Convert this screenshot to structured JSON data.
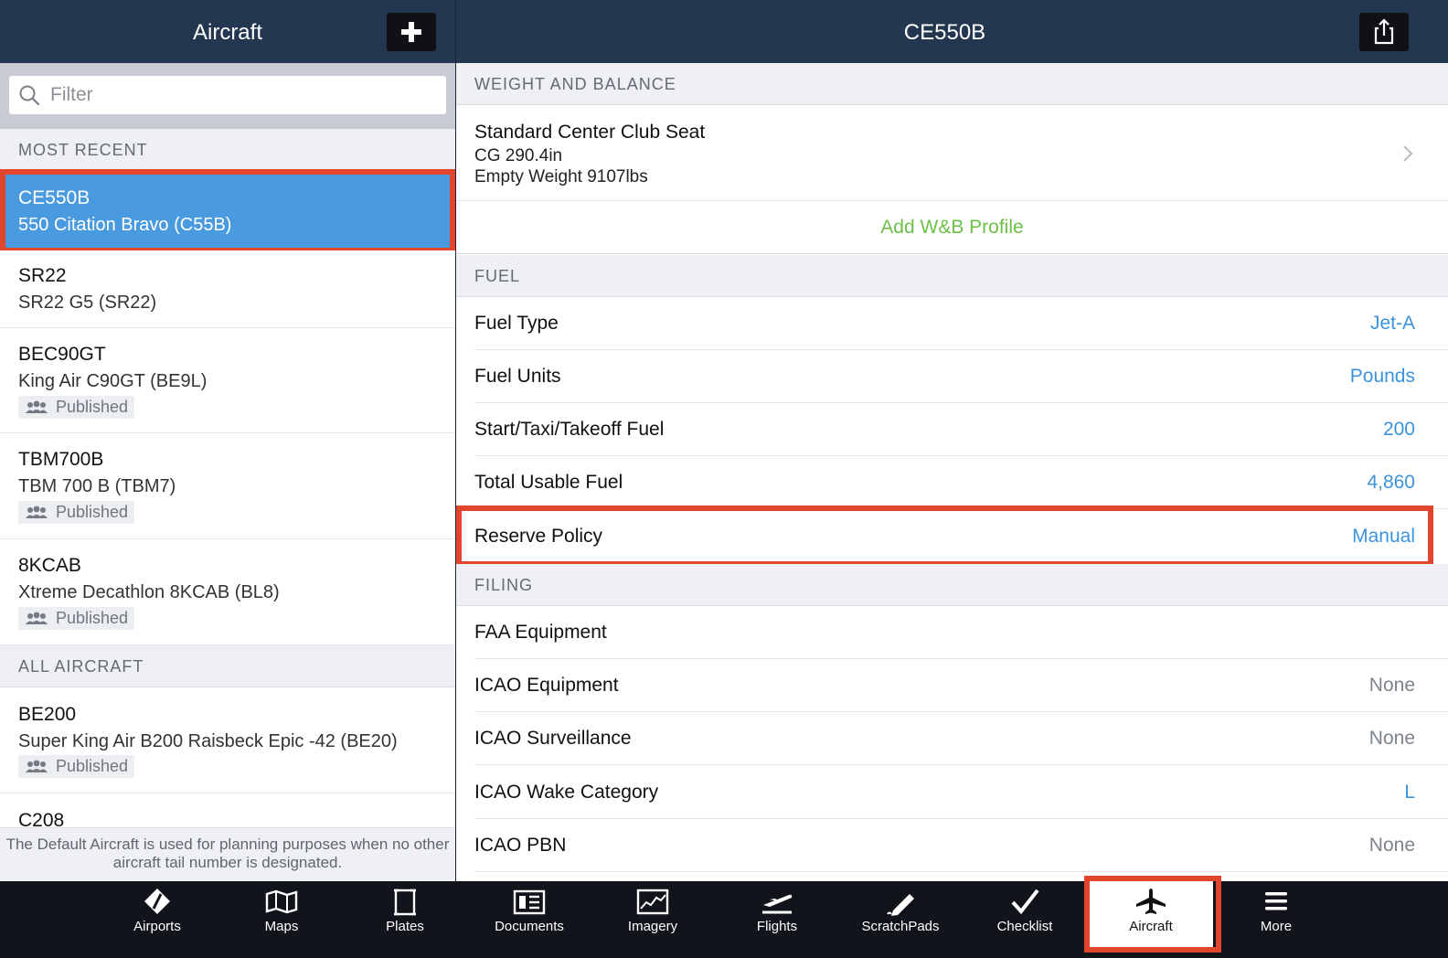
{
  "left_pane": {
    "title": "Aircraft",
    "add_icon": "plus-icon",
    "filter_placeholder": "Filter",
    "most_recent_header": "MOST RECENT",
    "all_aircraft_header": "ALL AIRCRAFT",
    "most_recent": [
      {
        "tail": "CE550B",
        "model": "550 Citation Bravo (C55B)",
        "badge": "",
        "selected": true
      },
      {
        "tail": "SR22",
        "model": "SR22 G5 (SR22)",
        "badge": ""
      },
      {
        "tail": "BEC90GT",
        "model": "King Air C90GT (BE9L)",
        "badge": "Published"
      },
      {
        "tail": "TBM700B",
        "model": "TBM 700 B (TBM7)",
        "badge": "Published"
      },
      {
        "tail": "8KCAB",
        "model": "Xtreme Decathlon 8KCAB (BL8)",
        "badge": "Published"
      }
    ],
    "all_aircraft": [
      {
        "tail": "BE200",
        "model": "Super King Air B200 Raisbeck Epic -42 (BE20)",
        "badge": "Published"
      },
      {
        "tail": "C208",
        "model": "",
        "badge": ""
      }
    ],
    "default_note": "The Default Aircraft is used for planning purposes when no other aircraft tail number is designated."
  },
  "right_pane": {
    "title": "CE550B",
    "share_icon": "share-icon",
    "wb_header": "WEIGHT AND BALANCE",
    "wb_profile": {
      "name": "Standard Center Club Seat",
      "cg": "CG 290.4in",
      "empty_weight": "Empty Weight 9107lbs"
    },
    "add_wb_label": "Add W&B Profile",
    "fuel_header": "FUEL",
    "fuel_rows": [
      {
        "label": "Fuel Type",
        "value": "Jet-A"
      },
      {
        "label": "Fuel Units",
        "value": "Pounds"
      },
      {
        "label": "Start/Taxi/Takeoff Fuel",
        "value": "200"
      },
      {
        "label": "Total Usable Fuel",
        "value": "4,860"
      },
      {
        "label": "Reserve Policy",
        "value": "Manual"
      }
    ],
    "filing_header": "FILING",
    "filing_rows": [
      {
        "label": "FAA Equipment",
        "value": ""
      },
      {
        "label": "ICAO Equipment",
        "value": "None"
      },
      {
        "label": "ICAO Surveillance",
        "value": "None"
      },
      {
        "label": "ICAO Wake Category",
        "value": "L"
      },
      {
        "label": "ICAO PBN",
        "value": "None"
      }
    ]
  },
  "tabbar": {
    "tabs": [
      {
        "label": "Airports",
        "icon": "airports-icon"
      },
      {
        "label": "Maps",
        "icon": "maps-icon"
      },
      {
        "label": "Plates",
        "icon": "plates-icon"
      },
      {
        "label": "Documents",
        "icon": "documents-icon"
      },
      {
        "label": "Imagery",
        "icon": "imagery-icon"
      },
      {
        "label": "Flights",
        "icon": "flights-icon"
      },
      {
        "label": "ScratchPads",
        "icon": "scratchpads-icon"
      },
      {
        "label": "Checklist",
        "icon": "checklist-icon"
      },
      {
        "label": "Aircraft",
        "icon": "airplane-icon",
        "active": true
      },
      {
        "label": "More",
        "icon": "more-icon"
      }
    ]
  },
  "colors": {
    "nav_bg": "#243750",
    "selected_row": "#4a9ae0",
    "highlight": "#e2452d",
    "value_blue": "#3d93db",
    "add_green": "#6cc04a",
    "tabbar_bg": "#11141a"
  }
}
